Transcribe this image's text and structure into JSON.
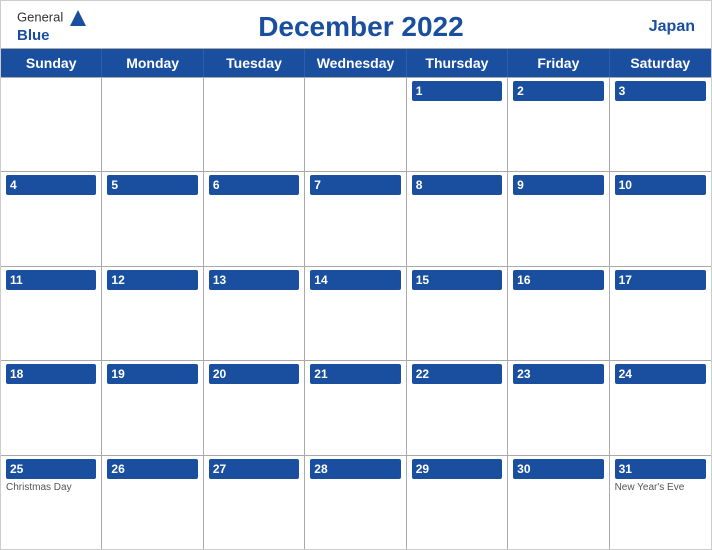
{
  "header": {
    "logo_general": "General",
    "logo_blue": "Blue",
    "title": "December 2022",
    "country": "Japan"
  },
  "day_headers": [
    "Sunday",
    "Monday",
    "Tuesday",
    "Wednesday",
    "Thursday",
    "Friday",
    "Saturday"
  ],
  "weeks": [
    [
      {
        "day": "",
        "event": ""
      },
      {
        "day": "",
        "event": ""
      },
      {
        "day": "",
        "event": ""
      },
      {
        "day": "",
        "event": ""
      },
      {
        "day": "1",
        "event": ""
      },
      {
        "day": "2",
        "event": ""
      },
      {
        "day": "3",
        "event": ""
      }
    ],
    [
      {
        "day": "4",
        "event": ""
      },
      {
        "day": "5",
        "event": ""
      },
      {
        "day": "6",
        "event": ""
      },
      {
        "day": "7",
        "event": ""
      },
      {
        "day": "8",
        "event": ""
      },
      {
        "day": "9",
        "event": ""
      },
      {
        "day": "10",
        "event": ""
      }
    ],
    [
      {
        "day": "11",
        "event": ""
      },
      {
        "day": "12",
        "event": ""
      },
      {
        "day": "13",
        "event": ""
      },
      {
        "day": "14",
        "event": ""
      },
      {
        "day": "15",
        "event": ""
      },
      {
        "day": "16",
        "event": ""
      },
      {
        "day": "17",
        "event": ""
      }
    ],
    [
      {
        "day": "18",
        "event": ""
      },
      {
        "day": "19",
        "event": ""
      },
      {
        "day": "20",
        "event": ""
      },
      {
        "day": "21",
        "event": ""
      },
      {
        "day": "22",
        "event": ""
      },
      {
        "day": "23",
        "event": ""
      },
      {
        "day": "24",
        "event": ""
      }
    ],
    [
      {
        "day": "25",
        "event": "Christmas Day"
      },
      {
        "day": "26",
        "event": ""
      },
      {
        "day": "27",
        "event": ""
      },
      {
        "day": "28",
        "event": ""
      },
      {
        "day": "29",
        "event": ""
      },
      {
        "day": "30",
        "event": ""
      },
      {
        "day": "31",
        "event": "New Year's Eve"
      }
    ]
  ],
  "colors": {
    "blue": "#1a4fa0",
    "white": "#ffffff",
    "border": "#aaaaaa"
  }
}
